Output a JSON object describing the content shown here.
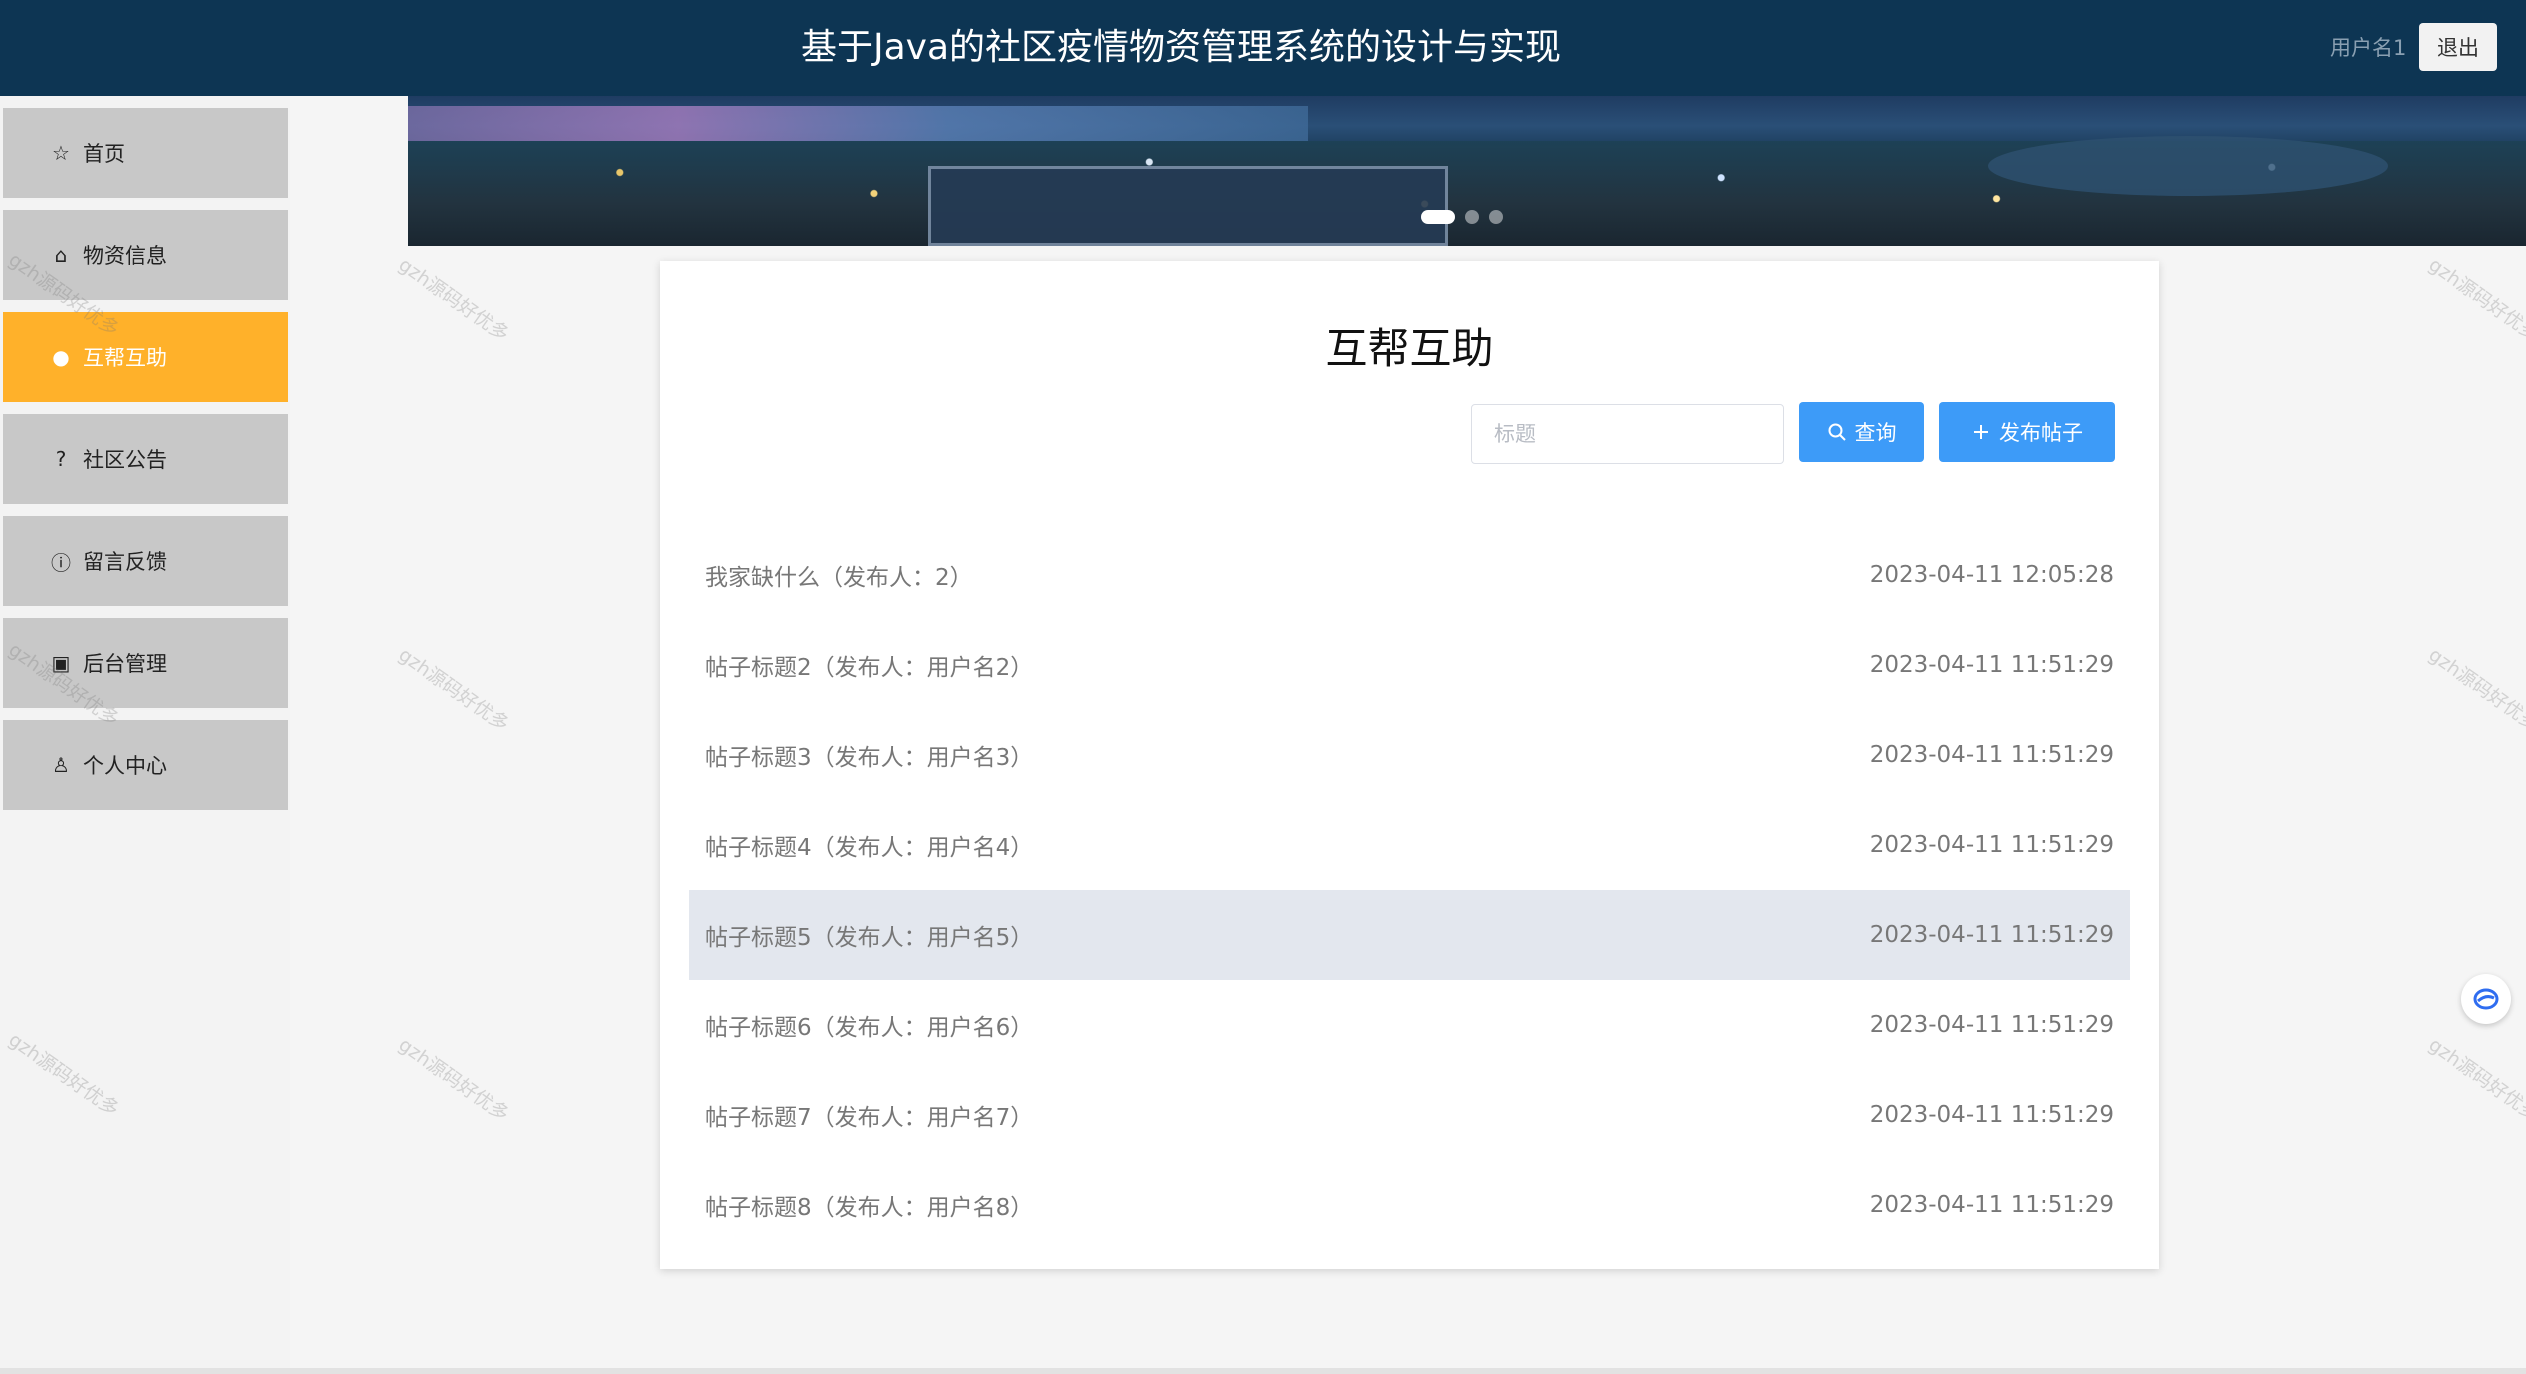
{
  "header": {
    "title": "基于Java的社区疫情物资管理系统的设计与实现",
    "username": "用户名1",
    "logout_label": "退出",
    "bg_color": "#0d3553"
  },
  "sidebar": {
    "items": [
      {
        "label": "首页",
        "icon": "star-icon",
        "active": false
      },
      {
        "label": "物资信息",
        "icon": "bag-icon",
        "active": false
      },
      {
        "label": "互帮互助",
        "icon": "info-circle-icon",
        "active": true
      },
      {
        "label": "社区公告",
        "icon": "question-circle-icon",
        "active": false
      },
      {
        "label": "留言反馈",
        "icon": "info-filled-icon",
        "active": false
      },
      {
        "label": "后台管理",
        "icon": "briefcase-icon",
        "active": false
      },
      {
        "label": "个人中心",
        "icon": "user-icon",
        "active": false
      }
    ],
    "active_color": "#ffb12a"
  },
  "main": {
    "title": "互帮互助",
    "search": {
      "placeholder": "标题",
      "value": ""
    },
    "query_label": "查询",
    "post_label": "发布帖子",
    "button_color": "#3d9bf8",
    "posts": [
      {
        "title": "我家缺什么（发布人：2）",
        "time": "2023-04-11 12:05:28"
      },
      {
        "title": "帖子标题2（发布人：用户名2）",
        "time": "2023-04-11 11:51:29"
      },
      {
        "title": "帖子标题3（发布人：用户名3）",
        "time": "2023-04-11 11:51:29"
      },
      {
        "title": "帖子标题4（发布人：用户名4）",
        "time": "2023-04-11 11:51:29"
      },
      {
        "title": "帖子标题5（发布人：用户名5）",
        "time": "2023-04-11 11:51:29"
      },
      {
        "title": "帖子标题6（发布人：用户名6）",
        "time": "2023-04-11 11:51:29"
      },
      {
        "title": "帖子标题7（发布人：用户名7）",
        "time": "2023-04-11 11:51:29"
      },
      {
        "title": "帖子标题8（发布人：用户名8）",
        "time": "2023-04-11 11:51:29"
      }
    ],
    "hovered_index": 4
  },
  "watermark": "gzh源码好优多"
}
